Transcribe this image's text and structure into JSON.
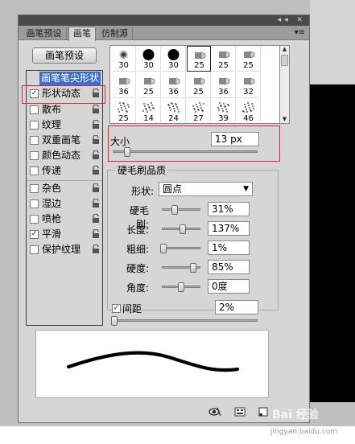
{
  "tabs": [
    {
      "label": "画笔预设"
    },
    {
      "label": "画笔"
    },
    {
      "label": "仿制源"
    }
  ],
  "window_controls": "◂◂ ✕",
  "menu_icon": "▾≡",
  "preset_button": "画笔预设",
  "left_items": [
    {
      "label": "画笔笔尖形状",
      "checkbox": false,
      "selected": true
    },
    {
      "label": "形状动态",
      "checkbox": true,
      "checked": true
    },
    {
      "label": "散布",
      "checkbox": true,
      "checked": false
    },
    {
      "label": "纹理",
      "checkbox": true,
      "checked": false
    },
    {
      "label": "双重画笔",
      "checkbox": true,
      "checked": false
    },
    {
      "label": "颜色动态",
      "checkbox": true,
      "checked": false
    },
    {
      "label": "传递",
      "checkbox": true,
      "checked": false
    },
    {
      "label": "杂色",
      "checkbox": true,
      "checked": false
    },
    {
      "label": "湿边",
      "checkbox": true,
      "checked": false
    },
    {
      "label": "喷枪",
      "checkbox": true,
      "checked": false
    },
    {
      "label": "平滑",
      "checkbox": true,
      "checked": true
    },
    {
      "label": "保护纹理",
      "checkbox": true,
      "checked": false
    }
  ],
  "check_mark": "✓",
  "tips": [
    {
      "n": "30",
      "icon": "soft-dot-icon"
    },
    {
      "n": "30",
      "icon": "hard-dot-icon"
    },
    {
      "n": "30",
      "icon": "hard-dot-icon"
    },
    {
      "n": "25",
      "icon": "bristle-tip-icon"
    },
    {
      "n": "25",
      "icon": "bristle-tip-icon"
    },
    {
      "n": "25",
      "icon": "bristle-tip-icon"
    },
    {
      "n": "36",
      "icon": "bristle-tip-icon"
    },
    {
      "n": "25",
      "icon": "bristle-tip-icon"
    },
    {
      "n": "36",
      "icon": "bristle-tip-icon"
    },
    {
      "n": "25",
      "icon": "bristle-tip-icon"
    },
    {
      "n": "36",
      "icon": "bristle-tip-icon"
    },
    {
      "n": "32",
      "icon": "bristle-tip-icon"
    },
    {
      "n": "25",
      "icon": "scatter-tip-icon"
    },
    {
      "n": "14",
      "icon": "scatter-tip-icon"
    },
    {
      "n": "24",
      "icon": "scatter-tip-icon"
    },
    {
      "n": "27",
      "icon": "scatter-tip-icon"
    },
    {
      "n": "39",
      "icon": "scatter-tip-icon"
    },
    {
      "n": "46",
      "icon": "scatter-tip-icon"
    }
  ],
  "size": {
    "label": "大小",
    "value": "13 px",
    "slider": 0.08
  },
  "bristle": {
    "title": "硬毛刷品质",
    "shape_label": "形状:",
    "shape_value": "圆点",
    "rows": [
      {
        "label": "硬毛刷:",
        "value": "31%",
        "level": 0.31
      },
      {
        "label": "长度:",
        "value": "137%",
        "level": 0.55
      },
      {
        "label": "粗细:",
        "value": "1%",
        "level": 0.01
      },
      {
        "label": "硬度:",
        "value": "85%",
        "level": 0.85
      },
      {
        "label": "角度:",
        "value": "0度",
        "level": 0.5
      }
    ]
  },
  "spacing": {
    "label": "间距",
    "checked": true,
    "value": "2%",
    "slider": 0.0
  },
  "watermark": "Bai 经验",
  "watermark_url": "jingyan.baidu.com"
}
